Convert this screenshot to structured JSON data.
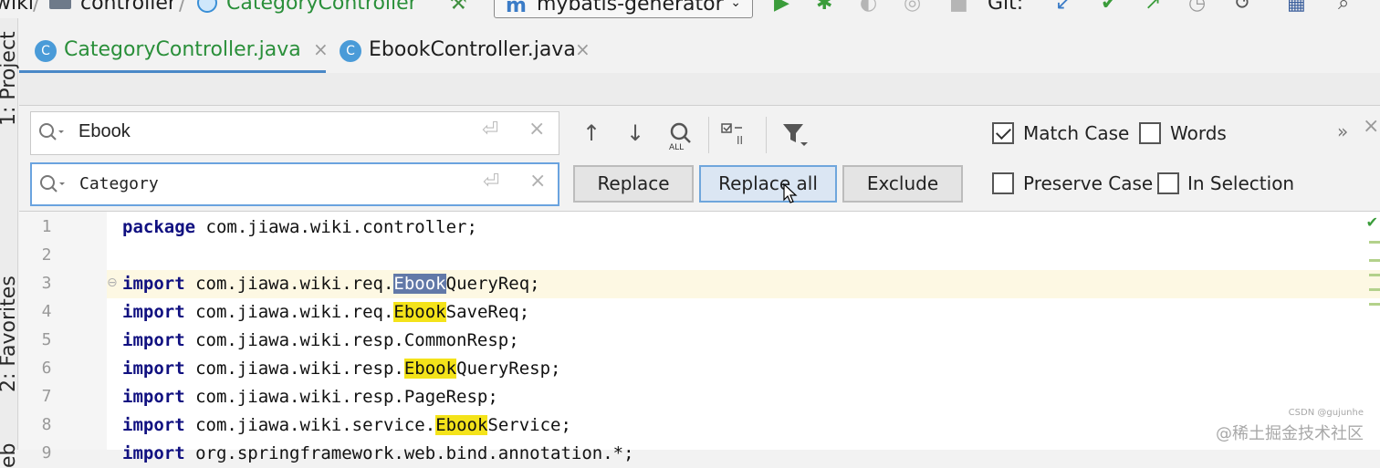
{
  "breadcrumb": {
    "project": "wiki",
    "folder": "controller",
    "file": "CategoryController"
  },
  "toolbar": {
    "run_config": "mybatis-generator",
    "git_label": "Git:"
  },
  "left_strip": {
    "project_label": "1: Project",
    "favorites_label": "2: Favorites",
    "web_label": "eb"
  },
  "tabs": [
    {
      "label": "CategoryController.java",
      "active": true
    },
    {
      "label": "EbookController.java",
      "active": false
    }
  ],
  "find": {
    "search_value": "Ebook",
    "replace_value": "Category",
    "buttons": {
      "replace": "Replace",
      "replace_all": "Replace all",
      "exclude": "Exclude"
    },
    "options": {
      "match_case": "Match Case",
      "words": "Words",
      "preserve_case": "Preserve Case",
      "in_selection": "In Selection"
    },
    "match_case_checked": true,
    "words_checked": false,
    "preserve_case_checked": false,
    "in_selection_checked": false,
    "more_icon": "»"
  },
  "editor": {
    "line_numbers": [
      "1",
      "2",
      "3",
      "4",
      "5",
      "6",
      "7",
      "8",
      "9"
    ],
    "lines": [
      {
        "kw": "package",
        "pre": " com.jiawa.wiki.controller;",
        "hl": "",
        "post": ""
      },
      {
        "kw": "",
        "pre": "",
        "hl": "",
        "post": ""
      },
      {
        "kw": "import",
        "pre": " com.jiawa.wiki.req.",
        "hl": "Ebook",
        "post": "QueryReq;",
        "current": true
      },
      {
        "kw": "import",
        "pre": " com.jiawa.wiki.req.",
        "hl": "Ebook",
        "post": "SaveReq;"
      },
      {
        "kw": "import",
        "pre": " com.jiawa.wiki.resp.CommonResp;",
        "hl": "",
        "post": ""
      },
      {
        "kw": "import",
        "pre": " com.jiawa.wiki.resp.",
        "hl": "Ebook",
        "post": "QueryResp;"
      },
      {
        "kw": "import",
        "pre": " com.jiawa.wiki.resp.PageResp;",
        "hl": "",
        "post": ""
      },
      {
        "kw": "import",
        "pre": " com.jiawa.wiki.service.",
        "hl": "Ebook",
        "post": "Service;"
      },
      {
        "kw": "import",
        "pre": " org.springframework.web.bind.annotation.*;",
        "hl": "",
        "post": ""
      }
    ]
  },
  "watermark": "@稀土掘金技术社区",
  "watermark_small": "CSDN @gujunhe",
  "colors": {
    "highlight": "#f4e31a",
    "current_match": "#6279a8",
    "keyword": "#101080",
    "accent": "#4a88c7"
  }
}
